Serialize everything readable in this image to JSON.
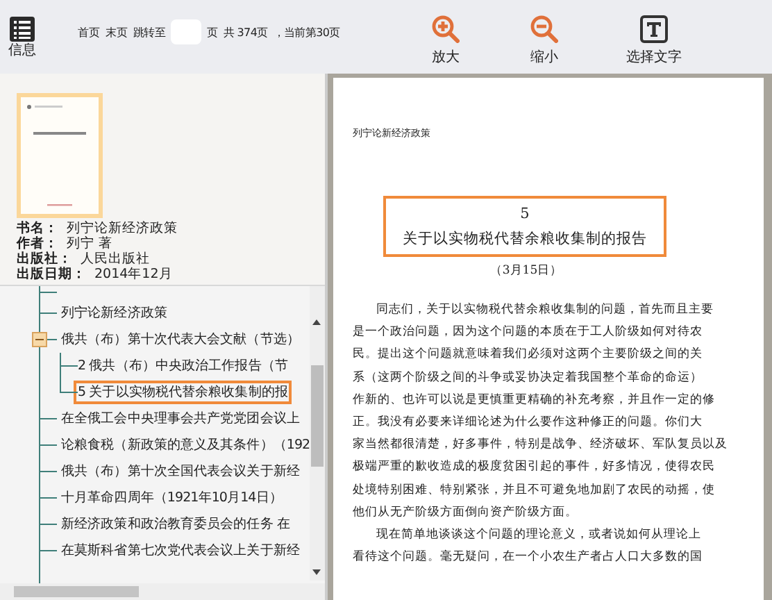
{
  "toolbar": {
    "info_label": "信息",
    "first_page": "首页",
    "last_page": "末页",
    "jump_to": "跳转至",
    "page_suffix": "页",
    "total": "共  374页",
    "current": "，当前第30页",
    "tools": [
      {
        "kind": "zoom-in",
        "label": "放大"
      },
      {
        "kind": "zoom-out",
        "label": "缩小"
      },
      {
        "kind": "select-text",
        "label": "选择文字"
      }
    ]
  },
  "book": {
    "fields": [
      {
        "label": "书名：",
        "value": "列宁论新经济政策"
      },
      {
        "label": "作者：",
        "value": "列宁  著"
      },
      {
        "label": "出版社：",
        "value": "人民出版社"
      },
      {
        "label": "出版日期：",
        "value": "2014年12月"
      }
    ]
  },
  "toc": [
    {
      "label": "列宁论新经济政策",
      "expanded": false,
      "selected": false
    },
    {
      "label": "俄共（布）第十次代表大会文献（节选）",
      "expanded": true,
      "selected": false,
      "children": [
        {
          "label": "2  俄共（布）中央政治工作报告（节",
          "selected": false
        },
        {
          "label": "5  关于以实物税代替余粮收集制的报",
          "selected": true
        }
      ]
    },
    {
      "label": "在全俄工会中央理事会共产党党团会议上",
      "expanded": false,
      "selected": false
    },
    {
      "label": "论粮食税（新政策的意义及其条件）（192",
      "expanded": false,
      "selected": false
    },
    {
      "label": "俄共（布）第十次全国代表会议关于新经",
      "expanded": false,
      "selected": false
    },
    {
      "label": "十月革命四周年（1921年10月14日）",
      "expanded": false,
      "selected": false
    },
    {
      "label": "新经济政策和政治教育委员会的任务  在",
      "expanded": false,
      "selected": false
    },
    {
      "label": "在莫斯科省第七次党代表会议上关于新经",
      "expanded": false,
      "selected": false
    }
  ],
  "page": {
    "header": "列宁论新经济政策",
    "number": "5",
    "title": "关于以实物税代替余粮收集制的报告",
    "title_highlighted": true,
    "date": "（3月15日）",
    "paragraphs": [
      [
        "同志们，关于以实物税代替余粮收集制的问题，首先而且主要",
        "是一个政治问题，因为这个问题的本质在于工人阶级如何对待农",
        "民。提出这个问题就意味着我们必须对这两个主要阶级之间的关",
        "系（这两个阶级之间的斗争或妥协决定着我国整个革命的命运）",
        "作新的、也许可以说是更慎重更精确的补充考察，并且作一定的修",
        "正。我没有必要来详细论述为什么要作这种修正的问题。你们大",
        "家当然都很清楚，好多事件，特别是战争、经济破坏、军队复员以及",
        "极端严重的歉收造成的极度贫困引起的事件，好多情况，使得农民",
        "处境特别困难、特别紧张，并且不可避免地加剧了农民的动摇，使",
        "他们从无产阶级方面倒向资产阶级方面。"
      ],
      [
        "现在简单地谈谈这个问题的理论意义，或者说如何从理论上",
        "看待这个问题。毫无疑问，在一个小农生产者占人口大多数的国"
      ]
    ]
  }
}
